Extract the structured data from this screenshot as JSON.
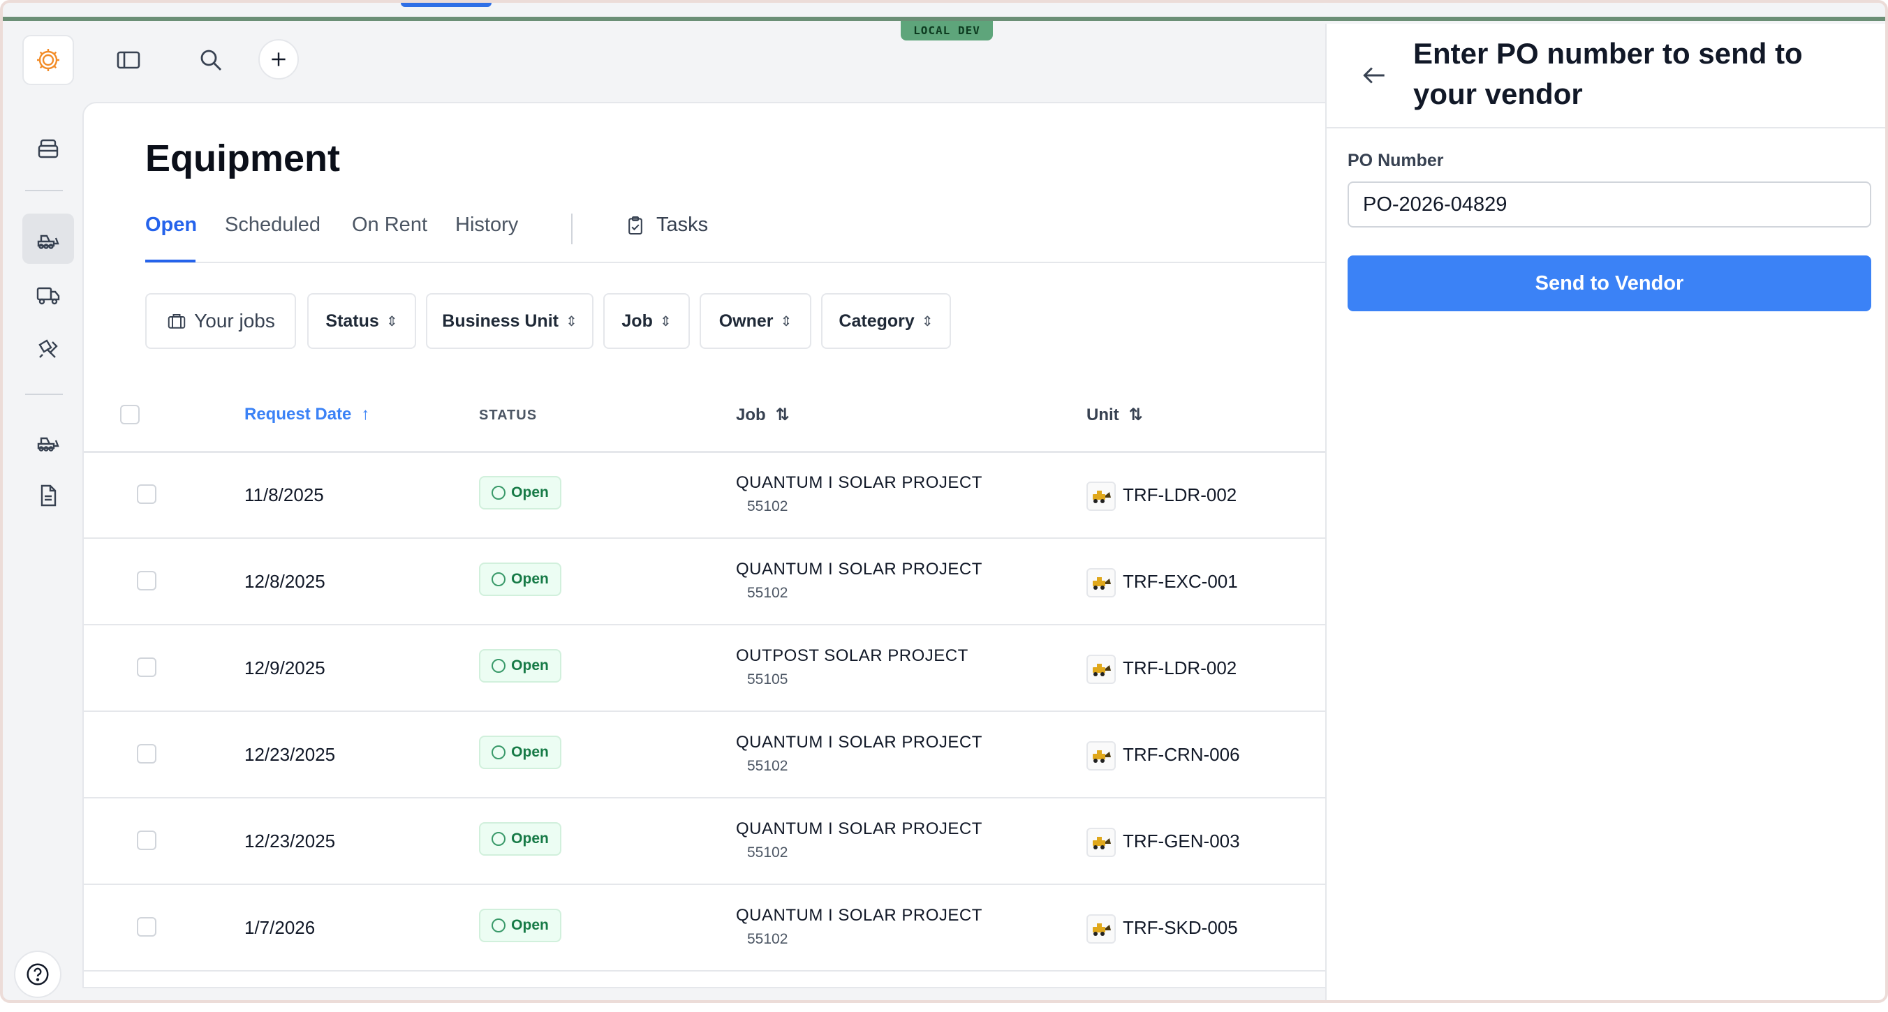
{
  "environment": {
    "badge": "LOCAL DEV",
    "stripe_color": "#6b8f76"
  },
  "rail": {
    "items": [
      {
        "icon": "logo-icon"
      },
      {
        "icon": "inventory-icon"
      },
      {
        "icon": "equipment-icon",
        "active": true
      },
      {
        "icon": "truck-icon"
      },
      {
        "icon": "tools-icon"
      },
      {
        "icon": "equipment-alt-icon"
      },
      {
        "icon": "document-icon"
      }
    ],
    "help_icon": "help-icon"
  },
  "topbar": {
    "icons": [
      "sidebar-toggle-icon",
      "search-icon",
      "plus-icon"
    ]
  },
  "page": {
    "title": "Equipment",
    "tabs": [
      {
        "label": "Open",
        "active": true
      },
      {
        "label": "Scheduled"
      },
      {
        "label": "On Rent"
      },
      {
        "label": "History"
      }
    ],
    "tasks_label": "Tasks",
    "filters": [
      {
        "label": "Your jobs"
      },
      {
        "label": "Status"
      },
      {
        "label": "Business Unit"
      },
      {
        "label": "Job"
      },
      {
        "label": "Owner"
      },
      {
        "label": "Category"
      }
    ],
    "chevron_glyph": "⌃⌄"
  },
  "table": {
    "headers": {
      "request_date": "Request Date",
      "status": "STATUS",
      "job": "Job",
      "unit": "Unit"
    },
    "rows": [
      {
        "date": "11/8/2025",
        "status": "Open",
        "job": "QUANTUM I SOLAR PROJECT",
        "job_number": "55102",
        "unit": "TRF-LDR-002"
      },
      {
        "date": "12/8/2025",
        "status": "Open",
        "job": "QUANTUM I SOLAR PROJECT",
        "job_number": "55102",
        "unit": "TRF-EXC-001"
      },
      {
        "date": "12/9/2025",
        "status": "Open",
        "job": "OUTPOST SOLAR PROJECT",
        "job_number": "55105",
        "unit": "TRF-LDR-002"
      },
      {
        "date": "12/23/2025",
        "status": "Open",
        "job": "QUANTUM I SOLAR PROJECT",
        "job_number": "55102",
        "unit": "TRF-CRN-006"
      },
      {
        "date": "12/23/2025",
        "status": "Open",
        "job": "QUANTUM I SOLAR PROJECT",
        "job_number": "55102",
        "unit": "TRF-GEN-003"
      },
      {
        "date": "1/7/2026",
        "status": "Open",
        "job": "QUANTUM I SOLAR PROJECT",
        "job_number": "55102",
        "unit": "TRF-SKD-005"
      }
    ]
  },
  "panel": {
    "title": "Enter PO number to send to your vendor",
    "po_label": "PO Number",
    "po_value": "PO-2026-04829",
    "send_label": "Send to Vendor"
  },
  "colors": {
    "accent": "#2563eb",
    "button": "#3b82f6",
    "status_open_bg": "#ecfdf3",
    "status_open_text": "#167a46",
    "logo_orange": "#f28c28"
  }
}
